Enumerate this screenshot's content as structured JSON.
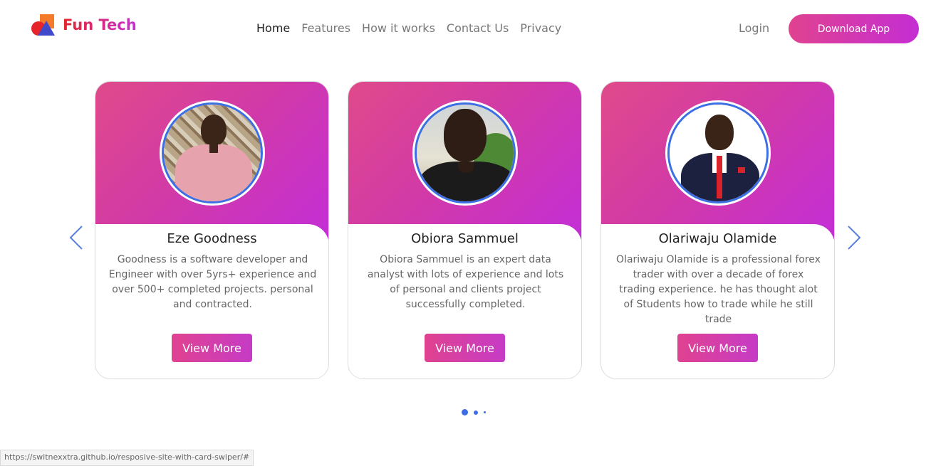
{
  "brand": {
    "name": "Fun Tech"
  },
  "nav": {
    "items": [
      {
        "label": "Home",
        "active": true
      },
      {
        "label": "Features",
        "active": false
      },
      {
        "label": "How it works",
        "active": false
      },
      {
        "label": "Contact Us",
        "active": false
      },
      {
        "label": "Privacy",
        "active": false
      }
    ],
    "login_label": "Login",
    "download_label": "Download App"
  },
  "cards": [
    {
      "name": "Eze Goodness",
      "description": "Goodness is a software developer and Engineer with over 5yrs+ experience and over 500+ completed projects. personal and contracted.",
      "button_label": "View More"
    },
    {
      "name": "Obiora Sammuel",
      "description": "Obiora Sammuel is an expert data analyst with lots of experience and lots of personal and clients project successfully completed.",
      "button_label": "View More"
    },
    {
      "name": "Olariwaju Olamide",
      "description": "Olariwaju Olamide is a professional forex trader with over a decade of forex trading experience. he has thought alot of Students how to trade while he still trade",
      "button_label": "View More"
    }
  ],
  "carousel": {
    "pages": 3,
    "active_page": 1
  },
  "status_bar": {
    "url": "https://switnexxtra.github.io/resposive-site-with-card-swiper/#"
  },
  "colors": {
    "accent_start": "#e04290",
    "accent_end": "#c42ed3",
    "ring": "#3c6ee6"
  }
}
